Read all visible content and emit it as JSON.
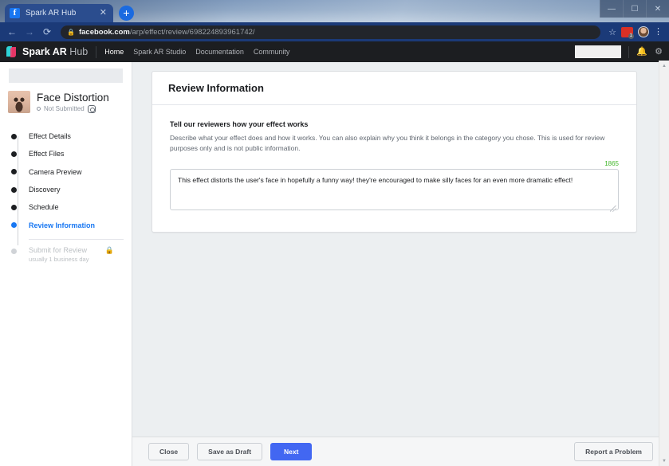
{
  "browser": {
    "tab": {
      "title": "Spark AR Hub",
      "favicon": "facebook-favicon",
      "close": "✕"
    },
    "new_tab": "+",
    "window_controls": {
      "minimize": "—",
      "maximize": "☐",
      "close": "✕"
    },
    "nav": {
      "back": "←",
      "forward": "→",
      "reload": "⟳"
    },
    "omnibox": {
      "lock": "🔒",
      "url_domain": "facebook.com",
      "url_path": "/arp/effect/review/698224893961742/"
    },
    "toolbar_right": {
      "bookmark": "☆",
      "extension_badge_count": "1",
      "profile": "profile-avatar",
      "menu": "⋮"
    }
  },
  "arnav": {
    "brand_bold": "Spark AR",
    "brand_light": "Hub",
    "links": [
      {
        "label": "Home",
        "active": true
      },
      {
        "label": "Spark AR Studio",
        "active": false
      },
      {
        "label": "Documentation",
        "active": false
      },
      {
        "label": "Community",
        "active": false
      }
    ],
    "notifications_icon": "🔔",
    "settings_icon": "⚙"
  },
  "sidebar": {
    "effect": {
      "title": "Face Distortion",
      "status": "Not Submitted",
      "platform_icon": "instagram-icon"
    },
    "steps": [
      {
        "label": "Effect Details",
        "state": "done"
      },
      {
        "label": "Effect Files",
        "state": "done"
      },
      {
        "label": "Camera Preview",
        "state": "done"
      },
      {
        "label": "Discovery",
        "state": "done"
      },
      {
        "label": "Schedule",
        "state": "done"
      },
      {
        "label": "Review Information",
        "state": "active"
      }
    ],
    "locked_step": {
      "label": "Submit for Review",
      "sublabel": "usually 1 business day",
      "lock_icon": "🔒"
    }
  },
  "main": {
    "card_title": "Review Information",
    "field": {
      "label": "Tell our reviewers how your effect works",
      "description": "Describe what your effect does and how it works. You can also explain why you think it belongs in the category you chose. This is used for review purposes only and is not public information.",
      "counter": "1865",
      "counter_color": "#42b72a",
      "value": "This effect distorts the user's face in hopefully a funny way! they're encouraged to make silly faces for an even more dramatic effect!",
      "placeholder": ""
    }
  },
  "footer": {
    "close_label": "Close",
    "save_draft_label": "Save as Draft",
    "next_label": "Next",
    "report_label": "Report a Problem"
  },
  "colors": {
    "accent_blue": "#4267f2",
    "link_blue": "#1877f2",
    "green": "#42b72a",
    "nav_dark": "#1c1e21"
  }
}
